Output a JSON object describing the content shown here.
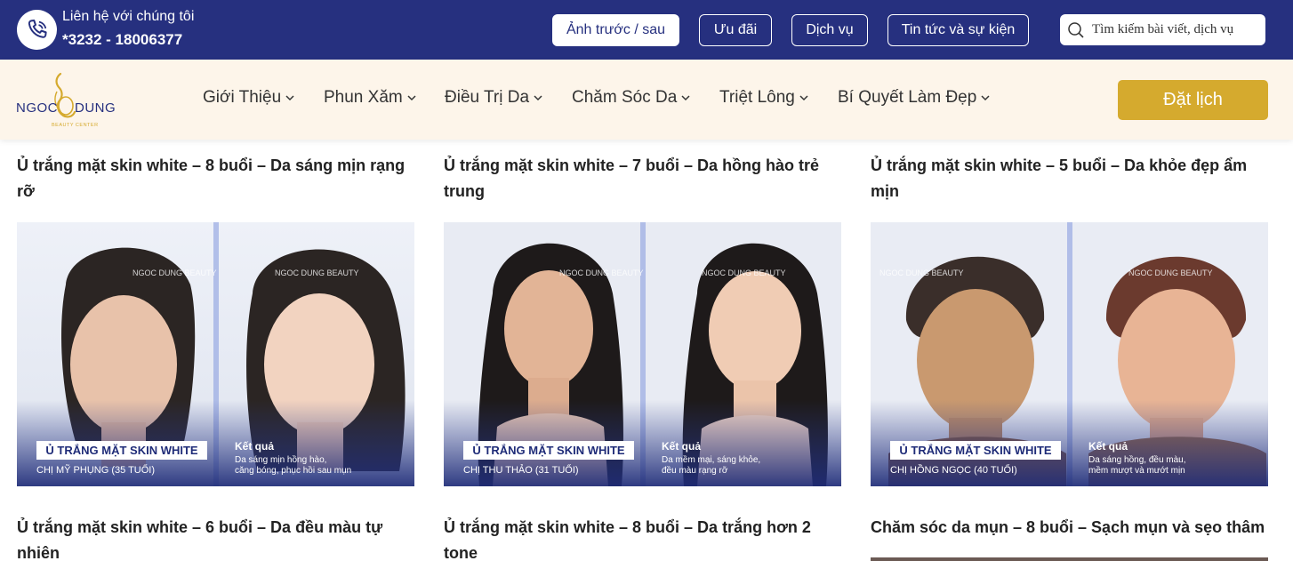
{
  "topbar": {
    "contact_label": "Liên hệ với chúng tôi",
    "contact_phone": "*3232 - 18006377",
    "buttons": [
      {
        "label": "Ảnh trước / sau",
        "active": true
      },
      {
        "label": "Ưu đãi",
        "active": false
      },
      {
        "label": "Dịch vụ",
        "active": false
      },
      {
        "label": "Tin tức và sự kiện",
        "active": false
      }
    ],
    "search": {
      "placeholder": "Tìm kiếm bài viết, dịch vụ"
    }
  },
  "logo": {
    "name": "NGOC DUNG",
    "subtitle": "BEAUTY CENTER"
  },
  "nav": {
    "items": [
      {
        "label": "Giới Thiệu"
      },
      {
        "label": "Phun Xăm"
      },
      {
        "label": "Điều Trị Da"
      },
      {
        "label": "Chăm Sóc Da"
      },
      {
        "label": "Triệt Lông"
      },
      {
        "label": "Bí Quyết Làm Đẹp"
      }
    ],
    "book_label": "Đặt lịch"
  },
  "cards": [
    {
      "title_line1": "Ủ trắng mặt skin white – 8 buổi – Da sáng mịn rạng",
      "title_line2": "rỡ",
      "image": {
        "watermark": "NGOC DUNG BEAUTY",
        "badge": "Ủ TRẮNG MẶT SKIN WHITE",
        "customer": "CHỊ MỸ PHỤNG (35 TUỔI)",
        "result_title": "Kết quả",
        "result_line1": "Da sáng mịn hồng hào,",
        "result_line2": "căng bóng, phục hồi sau mụn"
      }
    },
    {
      "title_line1": "Ủ trắng mặt skin white – 7 buổi – Da hồng hào trẻ",
      "title_line2": "trung",
      "image": {
        "watermark": "NGOC DUNG BEAUTY",
        "badge": "Ủ TRẮNG MẶT SKIN WHITE",
        "customer": "CHỊ THU THẢO (31 TUỔI)",
        "result_title": "Kết quả",
        "result_line1": "Da mềm mại, sáng khỏe,",
        "result_line2": "đều màu rạng rỡ"
      }
    },
    {
      "title_line1": "Ủ trắng mặt skin white – 5 buổi – Da khỏe đẹp ẩm",
      "title_line2": "mịn",
      "image": {
        "watermark": "NGOC DUNG BEAUTY",
        "badge": "Ủ TRẮNG MẶT SKIN WHITE",
        "customer": "CHỊ HỒNG NGỌC (40 TUỔI)",
        "result_title": "Kết quả",
        "result_line1": "Da sáng hồng, đều màu,",
        "result_line2": "mềm mượt và mướt mịn"
      }
    },
    {
      "title_line1": "Ủ trắng mặt skin white – 6 buổi – Da đều màu tự",
      "title_line2": "nhiên"
    },
    {
      "title_line1": "Ủ trắng mặt skin white – 8 buổi – Da trắng hơn 2",
      "title_line2": "tone"
    },
    {
      "title_line1": "Chăm sóc da mụn – 8 buổi – Sạch mụn và sẹo thâm",
      "title_line2": ""
    }
  ],
  "colors": {
    "primary": "#26307f",
    "accent": "#d5aa2e",
    "nav_bg": "#fdf5ea"
  }
}
